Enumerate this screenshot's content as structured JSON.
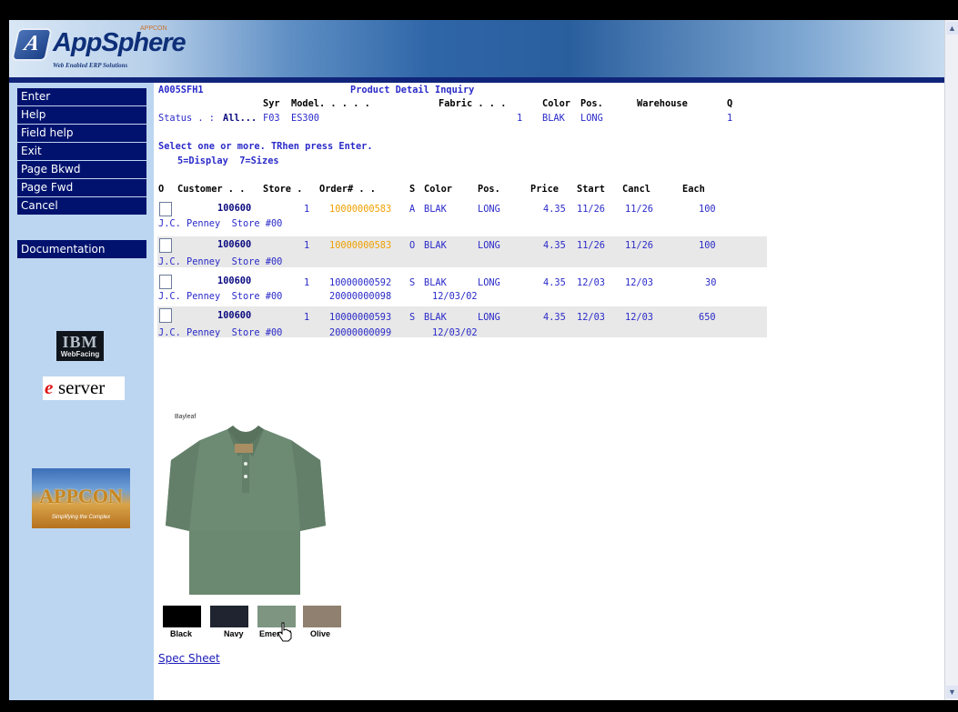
{
  "app": {
    "brand": "AppSphere",
    "brand_mark": "A",
    "brand_vendor": "APPCON",
    "brand_tagline": "Web Enabled ERP Solutions"
  },
  "menu": {
    "items": [
      "Enter",
      "Help",
      "Field help",
      "Exit",
      "Page Bkwd",
      "Page Fwd",
      "Cancel"
    ],
    "documentation": "Documentation"
  },
  "logos": {
    "ibm": "IBM",
    "webfacing": "WebFacing",
    "eserver_e": "e",
    "eserver_text": "server",
    "appcon": "APPCON",
    "appcon_tag": "Simplifying the Complex"
  },
  "screen": {
    "program_id": "A005SFH1",
    "title": "Product Detail Inquiry",
    "field_headers": {
      "syr": "Syr",
      "model": "Model. . . . .",
      "fabric": "Fabric . . .",
      "color": "Color",
      "pos": "Pos.",
      "warehouse": "Warehouse",
      "q": "Q"
    },
    "status_label": "Status . :",
    "status_value": "All...",
    "syr_value": "F03",
    "model_value": "ES300",
    "fabric_value": "1",
    "color_value": "BLAK",
    "pos_value": "LONG",
    "q_value": "1",
    "instruction": "Select one or more. TRhen press Enter.",
    "options": "5=Display  7=Sizes"
  },
  "table": {
    "headers": {
      "o": "O",
      "customer": "Customer . .",
      "store": "Store .",
      "order": "Order# . .",
      "s": "S",
      "color": "Color",
      "pos": "Pos.",
      "price": "Price",
      "start": "Start",
      "cancl": "Cancl",
      "each": "Each"
    },
    "rows": [
      {
        "customer": "100600",
        "store": "1",
        "order": "10000000583",
        "s": "A",
        "color": "BLAK",
        "pos": "LONG",
        "price": "4.35",
        "start": "11/26",
        "cancl": "11/26",
        "each": "100",
        "name": "J.C. Penney  Store #00",
        "ref": "",
        "date": ""
      },
      {
        "customer": "100600",
        "store": "1",
        "order": "10000000583",
        "s": "O",
        "color": "BLAK",
        "pos": "LONG",
        "price": "4.35",
        "start": "11/26",
        "cancl": "11/26",
        "each": "100",
        "name": "J.C. Penney  Store #00",
        "ref": "",
        "date": ""
      },
      {
        "customer": "100600",
        "store": "1",
        "order": "10000000592",
        "s": "S",
        "color": "BLAK",
        "pos": "LONG",
        "price": "4.35",
        "start": "12/03",
        "cancl": "12/03",
        "each": "30",
        "name": "J.C. Penney  Store #00",
        "ref": "20000000098",
        "date": "12/03/02"
      },
      {
        "customer": "100600",
        "store": "1",
        "order": "10000000593",
        "s": "S",
        "color": "BLAK",
        "pos": "LONG",
        "price": "4.35",
        "start": "12/03",
        "cancl": "12/03",
        "each": "650",
        "name": "J.C. Penney  Store #00",
        "ref": "20000000099",
        "date": "12/03/02"
      }
    ]
  },
  "product": {
    "brand": "Bayleaf",
    "swatches": [
      {
        "label": "Black",
        "color": "#000000"
      },
      {
        "label": "Navy",
        "color": "#1f2430"
      },
      {
        "label": "Emerald",
        "color": "#7e9582"
      },
      {
        "label": "Olive",
        "color": "#8f806f"
      }
    ],
    "spec_sheet": "Spec Sheet"
  }
}
